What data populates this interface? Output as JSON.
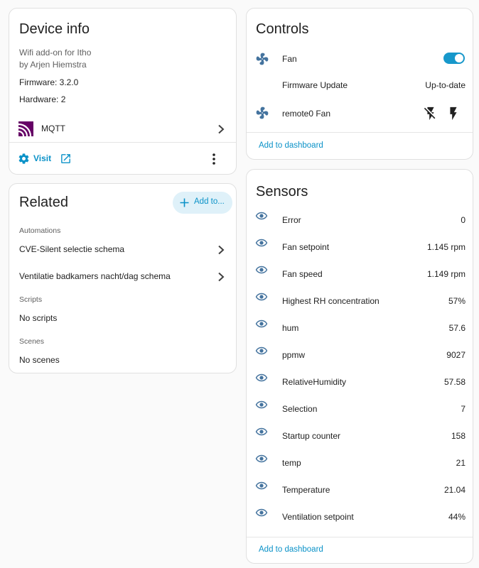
{
  "device_info": {
    "title": "Device info",
    "description_line1": "Wifi add-on for Itho",
    "description_line2": "by Arjen Hiemstra",
    "firmware": "Firmware: 3.2.0",
    "hardware": "Hardware: 2",
    "integration": "MQTT",
    "visit_label": "Visit"
  },
  "related": {
    "title": "Related",
    "add_button": "Add to...",
    "automations_label": "Automations",
    "automations": [
      "CVE-Silent selectie schema",
      "Ventilatie badkamers nacht/dag schema"
    ],
    "scripts_label": "Scripts",
    "scripts_empty": "No scripts",
    "scenes_label": "Scenes",
    "scenes_empty": "No scenes"
  },
  "controls": {
    "title": "Controls",
    "items": [
      {
        "label": "Fan",
        "icon": "fan-icon",
        "state": "on"
      },
      {
        "label": "Firmware Update",
        "value": "Up-to-date"
      },
      {
        "label": "remote0 Fan",
        "icon": "fan-icon"
      }
    ],
    "add_to_dashboard": "Add to dashboard"
  },
  "sensors": {
    "title": "Sensors",
    "items": [
      {
        "label": "Error",
        "value": "0"
      },
      {
        "label": "Fan setpoint",
        "value": "1.145 rpm"
      },
      {
        "label": "Fan speed",
        "value": "1.149 rpm"
      },
      {
        "label": "Highest RH concentration",
        "value": "57%"
      },
      {
        "label": "hum",
        "value": "57.6"
      },
      {
        "label": "ppmw",
        "value": "9027"
      },
      {
        "label": "RelativeHumidity",
        "value": "57.58"
      },
      {
        "label": "Selection",
        "value": "7"
      },
      {
        "label": "Startup counter",
        "value": "158"
      },
      {
        "label": "temp",
        "value": "21"
      },
      {
        "label": "Temperature",
        "value": "21.04"
      },
      {
        "label": "Ventilation setpoint",
        "value": "44%"
      }
    ],
    "add_to_dashboard": "Add to dashboard"
  },
  "colors": {
    "accent": "#0b92c8",
    "icon": "#44739e",
    "mqtt": "#660066"
  }
}
